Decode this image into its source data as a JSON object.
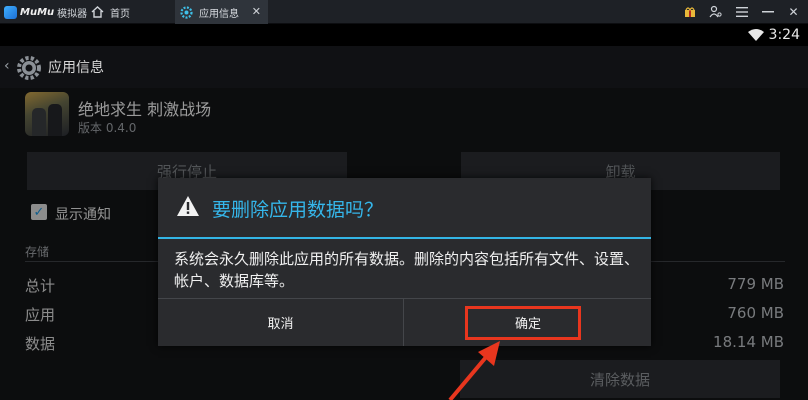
{
  "emulator": {
    "logo_text": "MuMu",
    "logo_sub": "模拟器",
    "tabs": [
      {
        "label": "首页"
      },
      {
        "label": "应用信息"
      }
    ]
  },
  "status_bar": {
    "time": "3:24"
  },
  "action_bar": {
    "title": "应用信息"
  },
  "app": {
    "name": "绝地求生 刺激战场",
    "version": "版本 0.4.0"
  },
  "buttons": {
    "force_stop": "强行停止",
    "uninstall": "卸载",
    "clear_data": "清除数据"
  },
  "notifications": {
    "label": "显示通知",
    "checked": true
  },
  "storage": {
    "header": "存储",
    "rows": [
      {
        "label": "总计",
        "value": "779 MB"
      },
      {
        "label": "应用",
        "value": "760 MB"
      },
      {
        "label": "数据",
        "value": "18.14 MB"
      }
    ]
  },
  "dialog": {
    "title": "要删除应用数据吗？",
    "message": "系统会永久删除此应用的所有数据。删除的内容包括所有文件、设置、帐户、数据库等。",
    "cancel": "取消",
    "confirm": "确定"
  },
  "colors": {
    "accent": "#33b5e5",
    "highlight": "#e8361e"
  }
}
